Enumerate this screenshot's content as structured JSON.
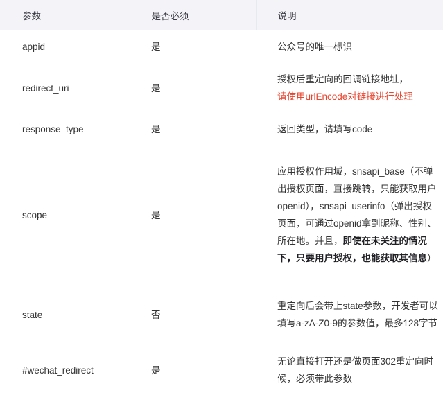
{
  "table": {
    "headers": {
      "param": "参数",
      "required": "是否必须",
      "description": "说明"
    },
    "rows": [
      {
        "param": "appid",
        "required": "是",
        "desc_plain": "公众号的唯一标识"
      },
      {
        "param": "redirect_uri",
        "required": "是",
        "desc_line1": "授权后重定向的回调链接地址，",
        "desc_line2_warn": "请使用urlEncode对链接进行处理"
      },
      {
        "param": "response_type",
        "required": "是",
        "desc_plain": "返回类型，请填写code"
      },
      {
        "param": "scope",
        "required": "是",
        "desc_normal_1": "应用授权作用域，snsapi_base（不弹出授权页面，直接跳转，只能获取用户openid），snsapi_userinfo（弹出授权页面，可通过openid拿到昵称、性别、所在地。并且，",
        "desc_bold": "即使在未关注的情况下，只要用户授权，也能获取其信息",
        "desc_normal_2": "）"
      },
      {
        "param": "state",
        "required": "否",
        "desc_plain": "重定向后会带上state参数，开发者可以填写a-zA-Z0-9的参数值，最多128字节"
      },
      {
        "param": "#wechat_redirect",
        "required": "是",
        "desc_plain": "无论直接打开还是做页面302重定向时候，必须带此参数"
      }
    ]
  },
  "colors": {
    "header_background": "#f4f4f8",
    "warning_text": "#e8442e",
    "body_text": "#333333",
    "divider": "#e8e8f0"
  }
}
